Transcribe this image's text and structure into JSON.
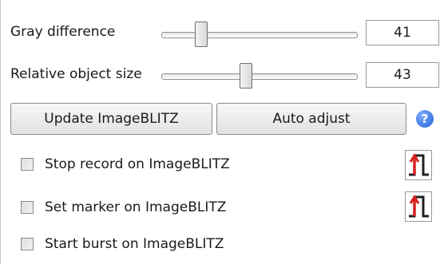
{
  "sliders": {
    "gray_difference": {
      "label": "Gray difference",
      "value": "41",
      "position": 0.21
    },
    "relative_object_size": {
      "label": "Relative object size",
      "value": "43",
      "position": 0.42
    }
  },
  "buttons": {
    "update_label": "Update ImageBLITZ",
    "auto_adjust_label": "Auto adjust"
  },
  "help_icon": {
    "glyph": "?",
    "icon": "help-icon",
    "color": "#1f5fd6"
  },
  "checkboxes": [
    {
      "label": "Stop record on ImageBLITZ",
      "checked": false,
      "trigger_icon": "rising-edge-pulse-icon"
    },
    {
      "label": "Set marker on ImageBLITZ",
      "checked": false,
      "trigger_icon": "rising-edge-pulse-icon"
    },
    {
      "label": "Start burst on ImageBLITZ",
      "checked": false
    }
  ],
  "colors": {
    "trigger_arrow": "#d62020",
    "trigger_line": "#222222"
  }
}
